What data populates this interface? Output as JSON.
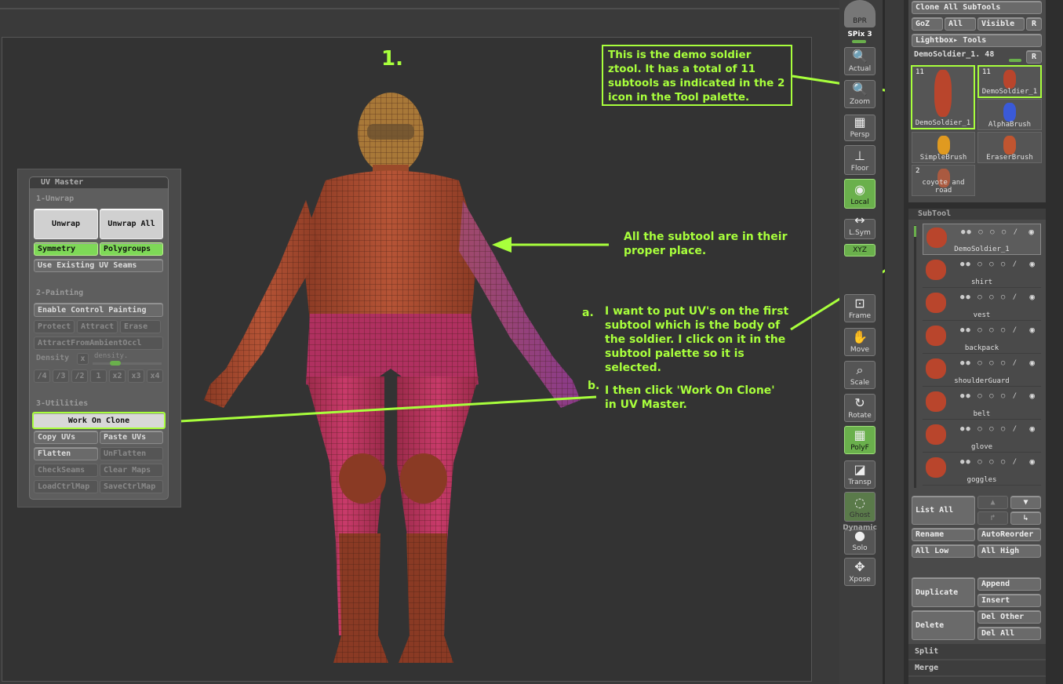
{
  "canvas": {
    "step_number": "1.",
    "annotation_box": "This is the demo soldier ztool. It has a total of 11 subtools as indicated in the 2 icon in the Tool palette.",
    "note_subtools": "All the subtool are in their proper place.",
    "note_a_marker": "a.",
    "note_a": "I want to put UV's on the first subtool which is the body of the soldier. I click on it in the subtool palette so it is selected.",
    "note_b_marker": "b.",
    "note_b": "I then click 'Work On Clone' in UV Master."
  },
  "uv_master": {
    "title": "UV Master",
    "section_unwrap": "1-Unwrap",
    "unwrap": "Unwrap",
    "unwrap_all": "Unwrap All",
    "symmetry": "Symmetry",
    "polygroups": "Polygroups",
    "use_existing_seams": "Use Existing UV Seams",
    "section_painting": "2-Painting",
    "enable_control_painting": "Enable Control Painting",
    "protect": "Protect",
    "attract": "Attract",
    "erase": "Erase",
    "attract_ambient": "AttractFromAmbientOccl",
    "density": "Density",
    "density_x": "x",
    "density_slider": "density.",
    "density_values": [
      "/4",
      "/3",
      "/2",
      "1",
      "x2",
      "x3",
      "x4"
    ],
    "section_utilities": "3-Utilities",
    "work_on_clone": "Work On Clone",
    "copy_uvs": "Copy UVs",
    "paste_uvs": "Paste UVs",
    "flatten": "Flatten",
    "unflatten": "UnFlatten",
    "check_seams": "CheckSeams",
    "clear_maps": "Clear Maps",
    "load_ctrl_map": "LoadCtrlMap",
    "save_ctrl_map": "SaveCtrlMap"
  },
  "shelf": {
    "bpr": "BPR",
    "spix": "SPix 3",
    "buttons": [
      "Actual",
      "Zoom",
      "Persp",
      "Floor",
      "Local",
      "L.Sym",
      "XYZ",
      "Frame",
      "Move",
      "Scale",
      "Rotate",
      "PolyF",
      "Transp",
      "Ghost",
      "Solo",
      "Xpose"
    ],
    "dynamic": "Dynamic"
  },
  "tool_palette": {
    "clone_all_subtools": "Clone All SubTools",
    "goz": "GoZ",
    "all": "All",
    "visible": "Visible",
    "r": "R",
    "lightbox_tools": "Lightbox▸ Tools",
    "current_tool": "DemoSoldier_1. 48",
    "thumbs": [
      {
        "label": "DemoSoldier_1",
        "count": "11"
      },
      {
        "label": "DemoSoldier_1",
        "count": "11"
      },
      {
        "label": "AlphaBrush",
        "count": ""
      },
      {
        "label": "SimpleBrush",
        "count": ""
      },
      {
        "label": "EraserBrush",
        "count": ""
      },
      {
        "label": "coyote and road",
        "count": "2"
      }
    ]
  },
  "subtool_palette": {
    "title": "SubTool",
    "items": [
      "DemoSoldier_1",
      "shirt",
      "vest",
      "backpack",
      "shoulderGuard",
      "belt",
      "glove",
      "goggles"
    ],
    "list_all": "List All",
    "rename": "Rename",
    "auto_reorder": "AutoReorder",
    "all_low": "All Low",
    "all_high": "All High",
    "duplicate": "Duplicate",
    "append": "Append",
    "insert": "Insert",
    "delete": "Delete",
    "del_other": "Del Other",
    "del_all": "Del All",
    "split": "Split",
    "merge": "Merge"
  },
  "colors": {
    "annotation": "#a8ff3c",
    "active_button": "#7ed957"
  }
}
